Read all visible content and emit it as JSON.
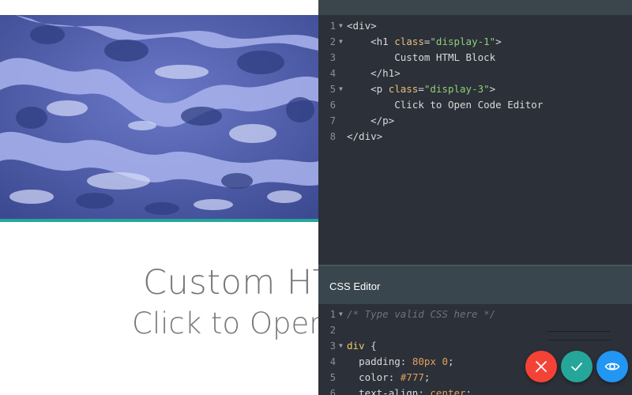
{
  "preview": {
    "heading": "Custom HTML Block",
    "subheading": "Click to Open Code Editor",
    "text_color": "#777777",
    "divider_color": "#26a69a",
    "image": "ocean-foam-photo"
  },
  "html_editor": {
    "lines": [
      {
        "num": "1",
        "fold": true,
        "indent": 0,
        "tokens": [
          {
            "t": "<div>",
            "c": "tag"
          }
        ]
      },
      {
        "num": "2",
        "fold": true,
        "indent": 4,
        "tokens": [
          {
            "t": "<h1 ",
            "c": "tag"
          },
          {
            "t": "class",
            "c": "attr"
          },
          {
            "t": "=",
            "c": "tag"
          },
          {
            "t": "\"display-1\"",
            "c": "str"
          },
          {
            "t": ">",
            "c": "tag"
          }
        ]
      },
      {
        "num": "3",
        "fold": false,
        "indent": 8,
        "tokens": [
          {
            "t": "Custom HTML Block",
            "c": "tag"
          }
        ]
      },
      {
        "num": "4",
        "fold": false,
        "indent": 4,
        "tokens": [
          {
            "t": "</h1>",
            "c": "tag"
          }
        ]
      },
      {
        "num": "5",
        "fold": true,
        "indent": 4,
        "tokens": [
          {
            "t": "<p ",
            "c": "tag"
          },
          {
            "t": "class",
            "c": "attr"
          },
          {
            "t": "=",
            "c": "tag"
          },
          {
            "t": "\"display-3\"",
            "c": "str"
          },
          {
            "t": ">",
            "c": "tag"
          }
        ]
      },
      {
        "num": "6",
        "fold": false,
        "indent": 8,
        "tokens": [
          {
            "t": "Click to Open Code Editor",
            "c": "tag"
          }
        ]
      },
      {
        "num": "7",
        "fold": false,
        "indent": 4,
        "tokens": [
          {
            "t": "</p>",
            "c": "tag"
          }
        ]
      },
      {
        "num": "8",
        "fold": false,
        "indent": 0,
        "tokens": [
          {
            "t": "</div>",
            "c": "tag"
          }
        ]
      }
    ]
  },
  "css_editor": {
    "title": "CSS Editor",
    "lines": [
      {
        "num": "1",
        "fold": true,
        "indent": 0,
        "tokens": [
          {
            "t": "/* Type valid CSS here */",
            "c": "cm"
          }
        ]
      },
      {
        "num": "2",
        "fold": false,
        "indent": 0,
        "tokens": []
      },
      {
        "num": "3",
        "fold": true,
        "indent": 0,
        "tokens": [
          {
            "t": "div",
            "c": "sel"
          },
          {
            "t": " {",
            "c": "tag"
          }
        ]
      },
      {
        "num": "4",
        "fold": false,
        "indent": 2,
        "tokens": [
          {
            "t": "padding",
            "c": "prop"
          },
          {
            "t": ": ",
            "c": "tag"
          },
          {
            "t": "80px 0",
            "c": "num"
          },
          {
            "t": ";",
            "c": "tag"
          }
        ]
      },
      {
        "num": "5",
        "fold": false,
        "indent": 2,
        "tokens": [
          {
            "t": "color",
            "c": "prop"
          },
          {
            "t": ": ",
            "c": "tag"
          },
          {
            "t": "#777",
            "c": "num"
          },
          {
            "t": ";",
            "c": "tag"
          }
        ]
      },
      {
        "num": "6",
        "fold": false,
        "indent": 2,
        "tokens": [
          {
            "t": "text-align",
            "c": "prop"
          },
          {
            "t": ": ",
            "c": "tag"
          },
          {
            "t": "center",
            "c": "num"
          },
          {
            "t": ";",
            "c": "tag"
          }
        ]
      }
    ]
  },
  "actions": {
    "cancel": {
      "icon": "close-icon",
      "color": "#f44336"
    },
    "confirm": {
      "icon": "check-icon",
      "color": "#26a69a"
    },
    "preview": {
      "icon": "eye-icon",
      "color": "#2196f3"
    }
  }
}
